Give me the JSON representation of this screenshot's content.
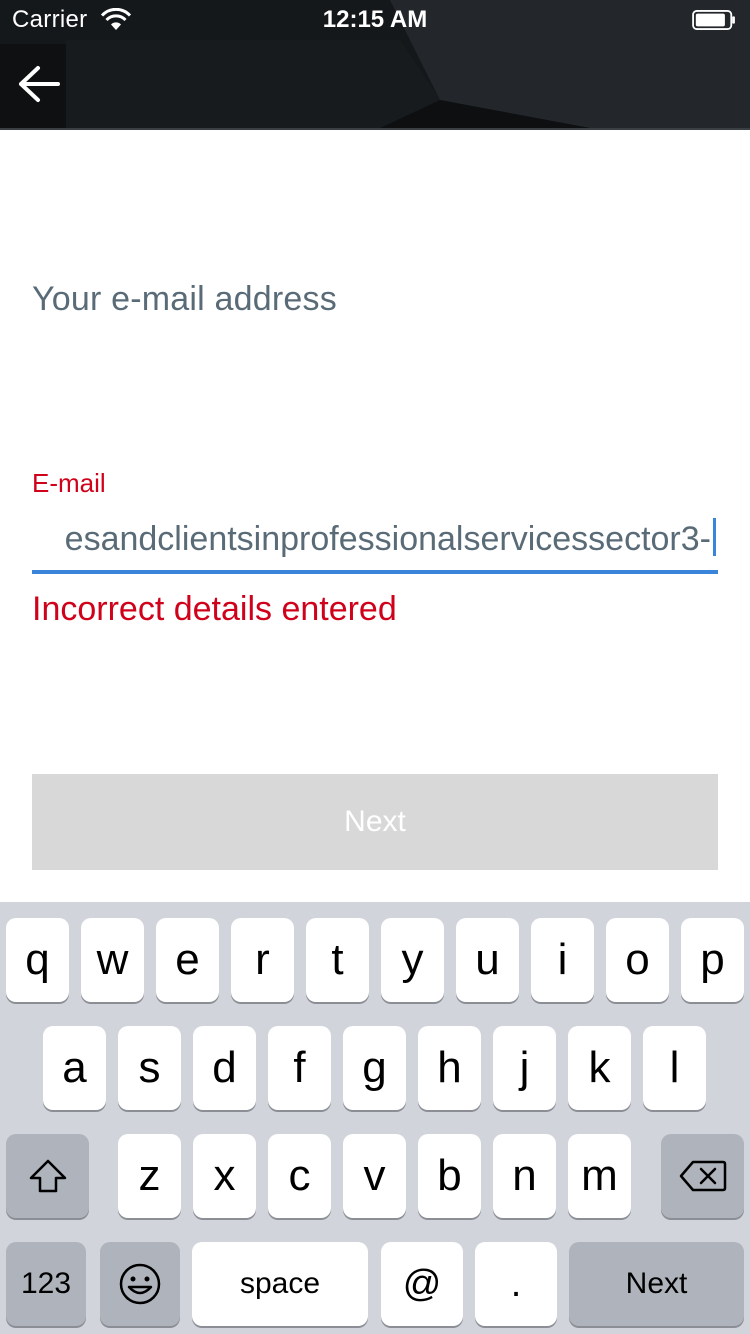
{
  "status_bar": {
    "carrier": "Carrier",
    "time": "12:15 AM"
  },
  "header": {
    "back_icon": "arrow-left-icon"
  },
  "page": {
    "heading": "Your e-mail address",
    "field_label": "E-mail",
    "email_value": "esandclientsinprofessionalservicessector3-",
    "error_message": "Incorrect details entered",
    "next_label": "Next"
  },
  "keyboard": {
    "row1": [
      "q",
      "w",
      "e",
      "r",
      "t",
      "y",
      "u",
      "i",
      "o",
      "p"
    ],
    "row2": [
      "a",
      "s",
      "d",
      "f",
      "g",
      "h",
      "j",
      "k",
      "l"
    ],
    "row3": [
      "z",
      "x",
      "c",
      "v",
      "b",
      "n",
      "m"
    ],
    "numbers_label": "123",
    "space_label": "space",
    "at_label": "@",
    "period_label": ".",
    "next_label": "Next",
    "shift_icon": "shift-icon",
    "backspace_icon": "backspace-icon",
    "emoji_icon": "emoji-icon"
  },
  "colors": {
    "error": "#d0021b",
    "accent": "#3a84d9",
    "heading": "#5a6b78",
    "disabled_button": "#d8d8d8"
  }
}
